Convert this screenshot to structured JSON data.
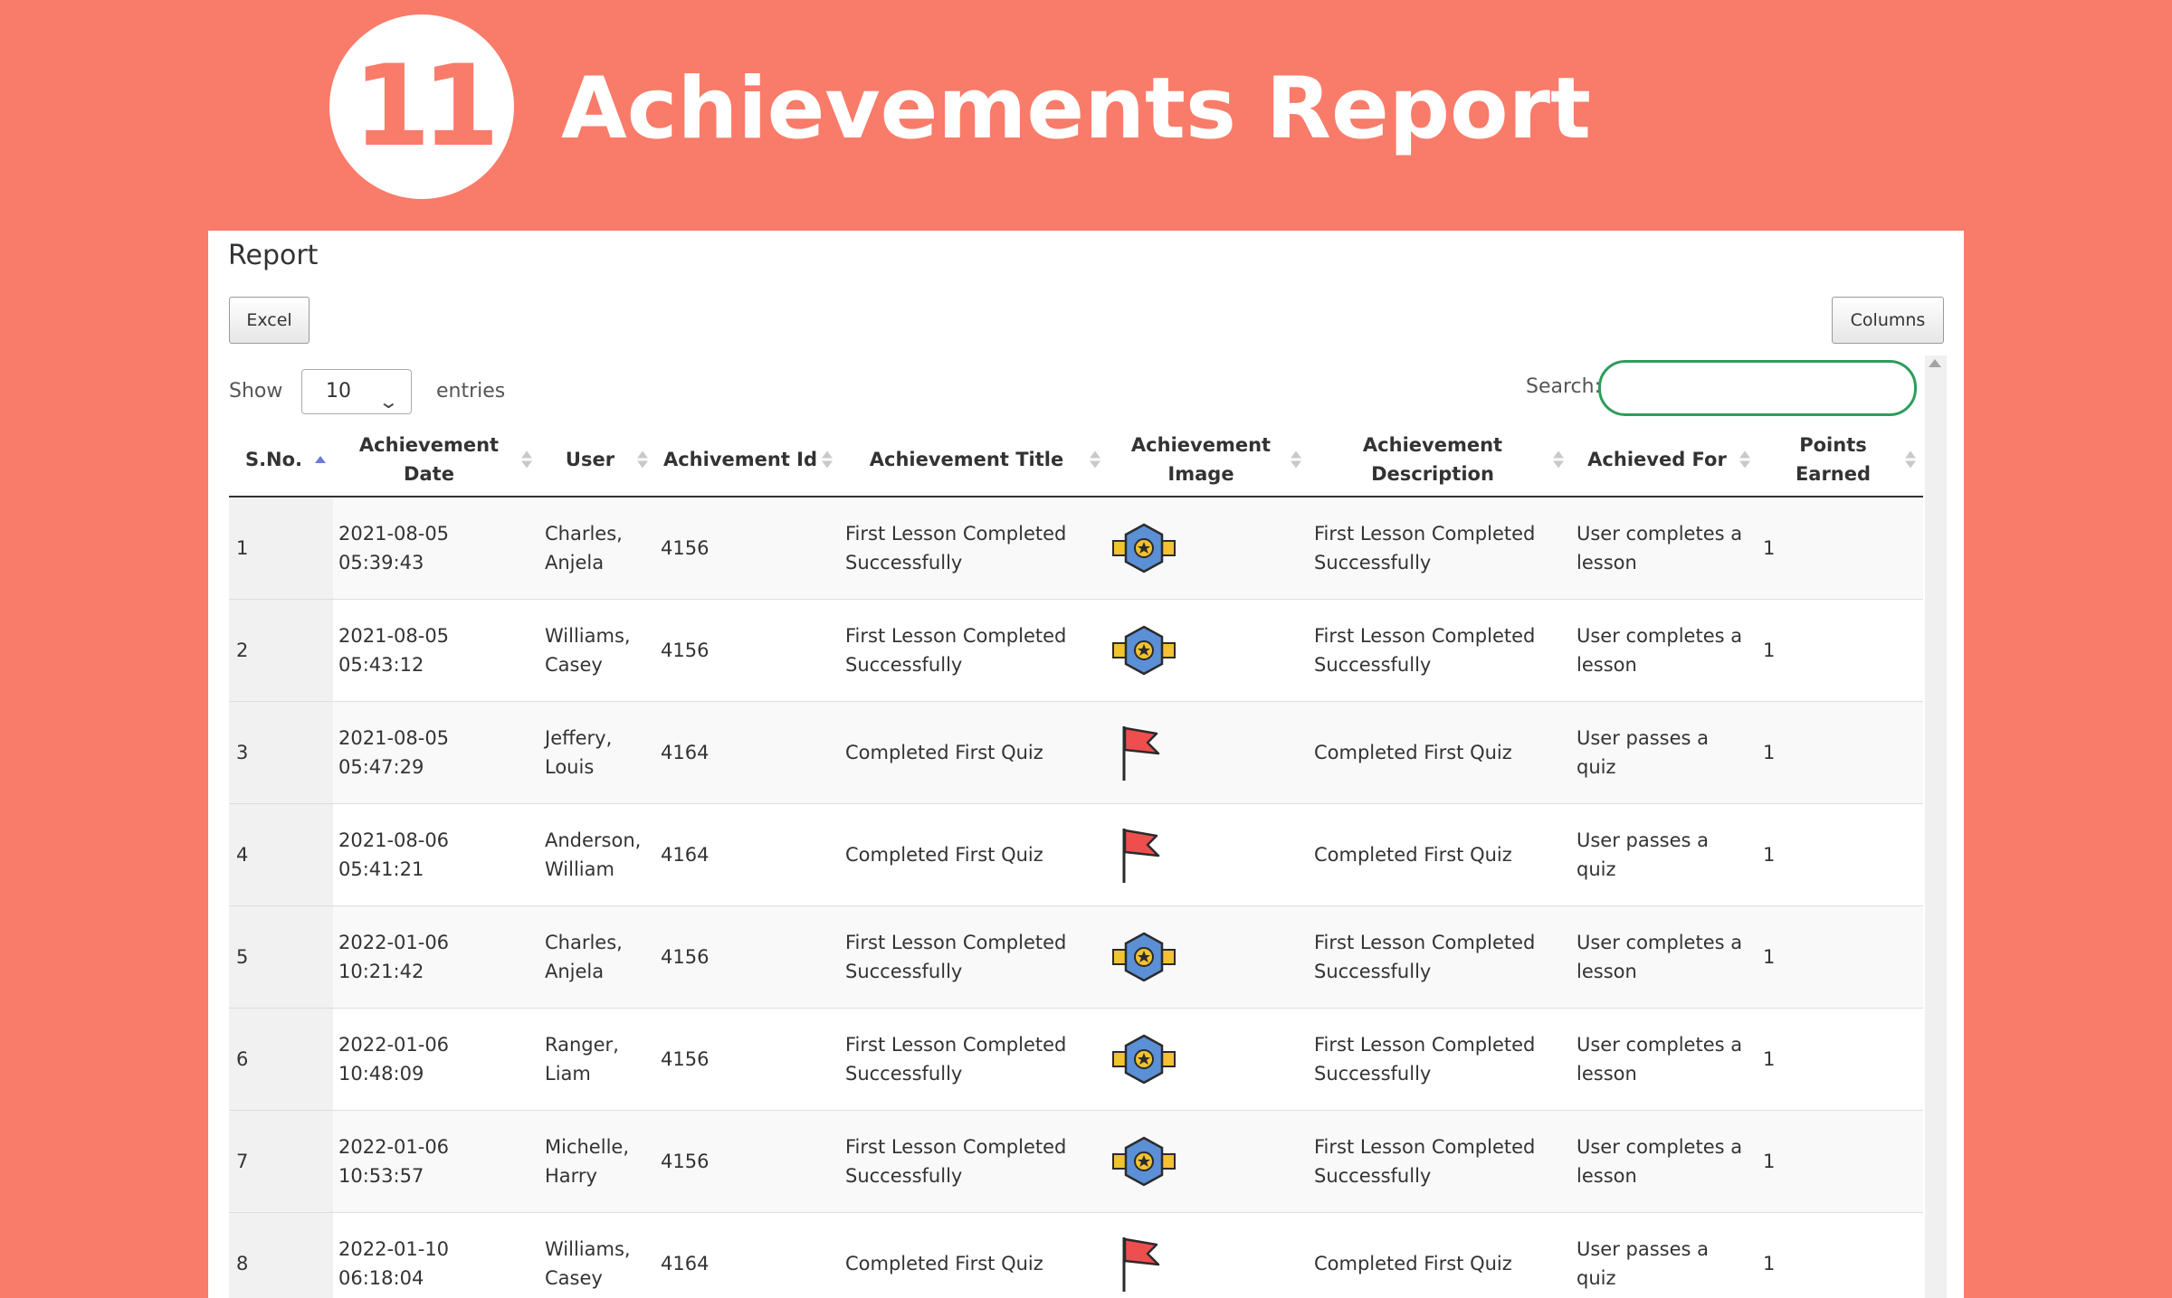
{
  "hero": {
    "number": "11",
    "title": "Achievements Report"
  },
  "report": {
    "title": "Report",
    "excel_label": "Excel",
    "columns_label": "Columns",
    "show_label": "Show",
    "entries_value": "10",
    "entries_label": "entries",
    "search_label": "Search:",
    "search_value": ""
  },
  "table": {
    "headers": [
      "S.No.",
      "Achievement Date",
      "User",
      "Achivement Id",
      "Achievement Title",
      "Achievement Image",
      "Achievement Description",
      "Achieved For",
      "Points Earned"
    ],
    "rows": [
      {
        "sno": "1",
        "date": "2021-08-05 05:39:43",
        "user": "Charles, Anjela",
        "id": "4156",
        "title": "First Lesson Completed Successfully",
        "image": "medal-icon",
        "description": "First Lesson Completed Successfully",
        "achieved_for": "User completes a lesson",
        "points": "1"
      },
      {
        "sno": "2",
        "date": "2021-08-05 05:43:12",
        "user": "Williams, Casey",
        "id": "4156",
        "title": "First Lesson Completed Successfully",
        "image": "medal-icon",
        "description": "First Lesson Completed Successfully",
        "achieved_for": "User completes a lesson",
        "points": "1"
      },
      {
        "sno": "3",
        "date": "2021-08-05 05:47:29",
        "user": "Jeffery, Louis",
        "id": "4164",
        "title": "Completed First Quiz",
        "image": "flag-icon",
        "description": "Completed First Quiz",
        "achieved_for": "User passes a quiz",
        "points": "1"
      },
      {
        "sno": "4",
        "date": "2021-08-06 05:41:21",
        "user": "Anderson, William",
        "id": "4164",
        "title": "Completed First Quiz",
        "image": "flag-icon",
        "description": "Completed First Quiz",
        "achieved_for": "User passes a quiz",
        "points": "1"
      },
      {
        "sno": "5",
        "date": "2022-01-06 10:21:42",
        "user": "Charles, Anjela",
        "id": "4156",
        "title": "First Lesson Completed Successfully",
        "image": "medal-icon",
        "description": "First Lesson Completed Successfully",
        "achieved_for": "User completes a lesson",
        "points": "1"
      },
      {
        "sno": "6",
        "date": "2022-01-06 10:48:09",
        "user": "Ranger, Liam",
        "id": "4156",
        "title": "First Lesson Completed Successfully",
        "image": "medal-icon",
        "description": "First Lesson Completed Successfully",
        "achieved_for": "User completes a lesson",
        "points": "1"
      },
      {
        "sno": "7",
        "date": "2022-01-06 10:53:57",
        "user": "Michelle, Harry",
        "id": "4156",
        "title": "First Lesson Completed Successfully",
        "image": "medal-icon",
        "description": "First Lesson Completed Successfully",
        "achieved_for": "User completes a lesson",
        "points": "1"
      },
      {
        "sno": "8",
        "date": "2022-01-10 06:18:04",
        "user": "Williams, Casey",
        "id": "4164",
        "title": "Completed First Quiz",
        "image": "flag-icon",
        "description": "Completed First Quiz",
        "achieved_for": "User passes a quiz",
        "points": "1"
      }
    ]
  },
  "colors": {
    "background": "#f97b69",
    "search_border": "#2e9c5a",
    "sort_active": "#6b7bd6"
  }
}
